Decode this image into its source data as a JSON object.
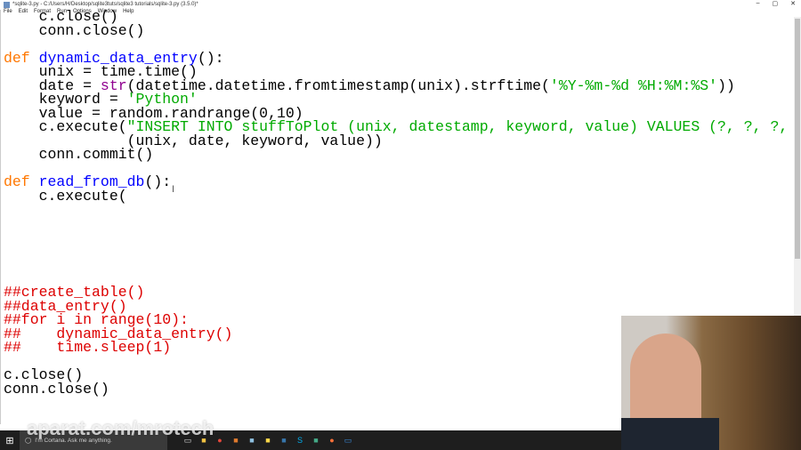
{
  "window": {
    "title": "*sqlite-3.py - C:/Users/H/Desktop/sqlite3tuts/sqlite3 tutorials/sqlite-3.py (3.5.0)*",
    "controls": [
      "–",
      "▢",
      "✕"
    ]
  },
  "menu": [
    "File",
    "Edit",
    "Format",
    "Run",
    "Options",
    "Window",
    "Help"
  ],
  "code": [
    [
      [
        "",
        "    c.close()"
      ]
    ],
    [
      [
        "",
        "    conn.close()"
      ]
    ],
    [],
    [
      [
        "kw",
        "def "
      ],
      [
        "fn",
        "dynamic_data_entry"
      ],
      [
        "",
        "():"
      ]
    ],
    [
      [
        "",
        "    unix = time.time()"
      ]
    ],
    [
      [
        "",
        "    date = "
      ],
      [
        "bi",
        "str"
      ],
      [
        "",
        "(datetime.datetime.fromtimestamp(unix).strftime("
      ],
      [
        "str",
        "'%Y-%m-%d %H:%M:%S'"
      ],
      [
        "",
        "))"
      ]
    ],
    [
      [
        "",
        "    keyword = "
      ],
      [
        "str",
        "'Python'"
      ]
    ],
    [
      [
        "",
        "    value = random.randrange(0,10)"
      ]
    ],
    [
      [
        "",
        "    c.execute("
      ],
      [
        "str",
        "\"INSERT INTO stuffToPlot (unix, datestamp, keyword, value) VALUES (?, ?, ?, ?)\""
      ],
      [
        "",
        ","
      ]
    ],
    [
      [
        "",
        "              (unix, date, keyword, value))"
      ]
    ],
    [
      [
        "",
        "    conn.commit()"
      ]
    ],
    [],
    [
      [
        "kw",
        "def "
      ],
      [
        "fn",
        "read_from_db"
      ],
      [
        "",
        "():"
      ]
    ],
    [
      [
        "",
        "    c.execute("
      ]
    ],
    [],
    [],
    [],
    [],
    [],
    [],
    [
      [
        "cm",
        "##create_table()"
      ]
    ],
    [
      [
        "cm",
        "##data_entry()"
      ]
    ],
    [
      [
        "cm",
        "##for i in range(10):"
      ]
    ],
    [
      [
        "cm",
        "##    dynamic_data_entry()"
      ]
    ],
    [
      [
        "cm",
        "##    time.sleep(1)"
      ]
    ],
    [],
    [
      [
        "",
        "c.close()"
      ]
    ],
    [
      [
        "",
        "conn.close()"
      ]
    ]
  ],
  "taskbar": {
    "start_icon": "windows-logo",
    "cortana": "I'm Cortana. Ask me anything.",
    "apps": [
      "task-view",
      "file-explorer",
      "chrome",
      "media-player",
      "notepad",
      "idle-python",
      "python",
      "skype",
      "app",
      "firefox",
      "messages"
    ]
  },
  "watermark": "aparat.com/mrotech"
}
